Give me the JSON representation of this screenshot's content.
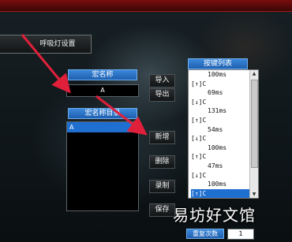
{
  "tabs": {
    "breathing_light": "呼吸灯设置"
  },
  "macro_name": {
    "label": "宏名称",
    "value": "A"
  },
  "macro_dir": {
    "label": "宏名称目录",
    "items": [
      "A"
    ]
  },
  "buttons": {
    "import": "导入",
    "export": "导出",
    "new": "新增",
    "delete": "删除",
    "record": "录制",
    "save": "保存"
  },
  "key_list": {
    "label": "按键列表",
    "rows": [
      {
        "text": "100ms",
        "indent": true
      },
      {
        "text": "[↑]C",
        "indent": false
      },
      {
        "text": "69ms",
        "indent": true
      },
      {
        "text": "[↓]C",
        "indent": false
      },
      {
        "text": "131ms",
        "indent": true
      },
      {
        "text": "[↑]C",
        "indent": false
      },
      {
        "text": "54ms",
        "indent": true
      },
      {
        "text": "[↓]C",
        "indent": false
      },
      {
        "text": "100ms",
        "indent": true
      },
      {
        "text": "[↑]C",
        "indent": false
      },
      {
        "text": "47ms",
        "indent": true
      },
      {
        "text": "[↓]C",
        "indent": false
      },
      {
        "text": "100ms",
        "indent": true
      },
      {
        "text": "[↑]C",
        "indent": false,
        "selected": true
      }
    ]
  },
  "repeat": {
    "label": "重复次数",
    "value": "1"
  },
  "watermark": "易坊好文馆",
  "colors": {
    "accent_red": "#e0203a",
    "selection_blue": "#1f6fd0"
  }
}
